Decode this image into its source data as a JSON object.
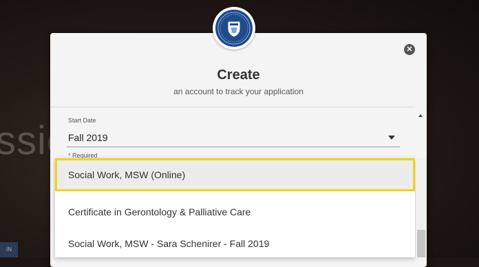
{
  "background": {
    "text_fragment": "ssic",
    "badge_text": "IN"
  },
  "modal": {
    "logo_icon": "university-shield-icon",
    "close_icon": "close-circle-icon",
    "close_glyph": "✕",
    "title": "Create",
    "subtitle": "an account to track your application"
  },
  "start_date": {
    "label": "Start Date",
    "value": "Fall 2019",
    "required_star": "*",
    "required_text": " Required"
  },
  "program_dropdown": {
    "options": [
      "Social Work, MSW (Online)",
      "Certificate in Gerontology & Palliative Care",
      "Social Work, MSW - Sara Schenirer - Fall 2019"
    ],
    "highlighted_index": 0
  },
  "colors": {
    "highlight_border": "#f2d31b",
    "logo_blue": "#1f4b8c"
  }
}
